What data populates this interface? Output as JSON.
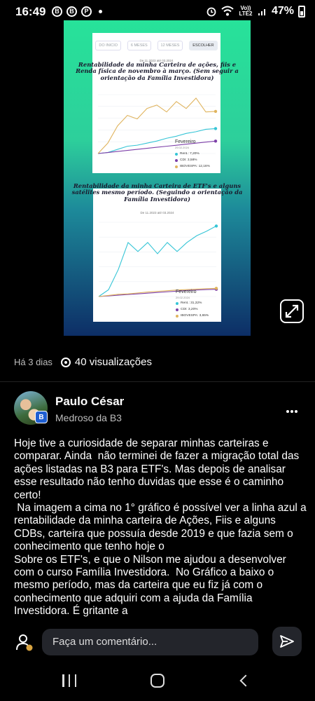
{
  "status_bar": {
    "time": "16:49",
    "notification_icons": [
      "b-icon",
      "b-icon",
      "pinterest-icon"
    ],
    "network_label": "Vo)) LTE2",
    "battery": "47%"
  },
  "image": {
    "chart1": {
      "tabs": [
        "DO INICIO",
        "6 MESES",
        "12 MESES",
        "ESCOLHER"
      ],
      "selected_tab": "ESCOLHER",
      "date_range": "De 11.2023 até 03.2024",
      "caption": "Rentabilidade da minha Carteira de ações, fiis e Renda física de novembro à março. (Sem seguir a orientação da Família Investidora)",
      "month": "Fevereiro",
      "month_date": "29.02.2024",
      "legend": [
        {
          "label": "Rent.: 7,20%",
          "color": "#35c5d6"
        },
        {
          "label": "CDI: 3,58%",
          "color": "#7d3fa8"
        },
        {
          "label": "IBOVESPA: 12,16%",
          "color": "#e0b45e"
        }
      ],
      "series": {
        "rent": [
          0,
          0.3,
          1.2,
          2.1,
          2.4,
          3.0,
          3.6,
          4.4,
          5.0,
          5.8,
          6.3,
          7.0,
          7.2
        ],
        "cdi": [
          0,
          0.3,
          0.6,
          0.9,
          1.2,
          1.5,
          1.8,
          2.1,
          2.4,
          2.7,
          3.0,
          3.3,
          3.58
        ],
        "ibov": [
          0,
          3,
          8,
          11,
          10,
          13,
          14,
          12,
          15,
          13,
          16,
          12,
          12.16
        ]
      }
    },
    "chart2": {
      "date_range": "De 11.2023 até 03.2024",
      "caption": "Rentabilidade da minha Carteira de ETF's e alguns satélites mesmo período. (Seguindo a orientação da Família Investidora)",
      "month": "Fevereiro",
      "month_date": "29.02.2024",
      "legend": [
        {
          "label": "Rent.: 31,32%",
          "color": "#35c5d6"
        },
        {
          "label": "CDI: 3,20%",
          "color": "#7d3fa8"
        },
        {
          "label": "IBOVESPA: 3,65%",
          "color": "#e0b45e"
        }
      ],
      "series": {
        "rent": [
          0,
          3,
          12,
          24,
          20,
          24,
          19,
          24,
          20,
          24,
          27,
          29,
          31.32
        ],
        "cdi": [
          0,
          0.3,
          0.6,
          0.9,
          1.2,
          1.5,
          1.8,
          2.1,
          2.4,
          2.7,
          2.9,
          3.1,
          3.2
        ],
        "ibov": [
          0,
          0.5,
          1,
          1.2,
          1.6,
          2,
          2.3,
          2.6,
          2.9,
          3.1,
          3.3,
          3.5,
          3.65
        ]
      }
    }
  },
  "expand_icon": "expand-icon",
  "meta": {
    "posted": "Há 3 dias",
    "views": "40 visualizações"
  },
  "author": {
    "name": "Paulo César",
    "subtitle": "Medroso da B3",
    "badge": "B"
  },
  "post_text": "Hoje tive a curiosidade de separar minhas carteiras e comparar. Ainda  não terminei de fazer a migração total das ações listadas na B3 para ETF's. Mas depois de analisar esse resultado não tenho duvidas que esse é o caminho certo!\n Na imagem a cima no 1° gráfico é possível ver a linha azul a rentabilidade da minha carteira de Ações, Fiis e alguns CDBs, carteira que possuía desde 2019 e que fazia sem o conhecimento que tenho hoje o\nSobre os ETF's, e que o Nilson me ajudou a desenvolver com o curso Família Investidora.  No Gráfico a baixo o mesmo período, mas da carteira que eu fiz já com o conhecimento que adquiri com a ajuda da Família Investidora. É gritante a",
  "comment": {
    "placeholder": "Faça um comentário..."
  }
}
